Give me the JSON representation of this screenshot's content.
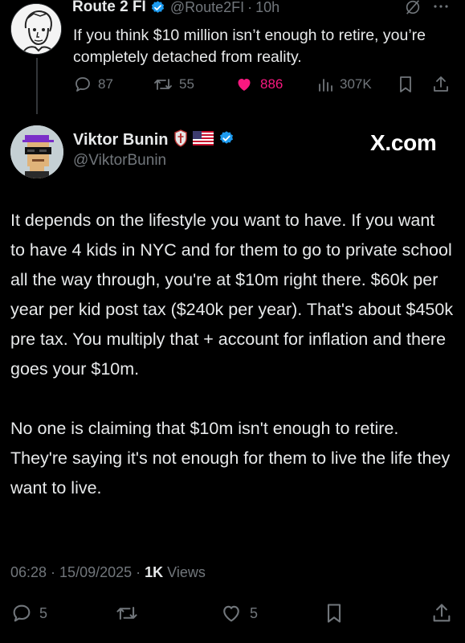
{
  "parent": {
    "name": "Route 2 FI",
    "handle": "@Route2FI",
    "separator": "·",
    "time": "10h",
    "text": "If you think $10 million isn’t enough to retire, you’re completely detached from reality.",
    "actions": {
      "replies": "87",
      "retweets": "55",
      "likes": "886",
      "views": "307K"
    },
    "liked": true
  },
  "tweet": {
    "name": "Viktor Bunin",
    "handle": "@ViktorBunin",
    "watermark": "X.com",
    "paragraphs": [
      "It depends on the lifestyle you want to have. If you want to have 4 kids in NYC and for them to go to private school all the way through, you're at $10m right there. $60k per year per kid post tax ($240k per year). That's about $450k pre tax. You multiply that + account for inflation and there goes your $10m.",
      "No one is claiming that $10m isn't enough to retire. They're saying it's not enough for them to live the life they want to live."
    ],
    "meta": {
      "time": "06:28",
      "dot1": " · ",
      "date": "15/09/2025",
      "dot2": " · ",
      "views_count": "1K",
      "views_label": " Views"
    },
    "actions": {
      "replies": "5",
      "likes": "5"
    }
  },
  "colors": {
    "background": "#000000",
    "text": "#e7e9ea",
    "muted": "#71767b",
    "verified": "#1d9bf0",
    "like": "#f91880"
  },
  "icons": {
    "verified": "verified-badge-icon",
    "reply": "reply-icon",
    "retweet": "retweet-icon",
    "like": "heart-icon",
    "views": "views-icon",
    "bookmark": "bookmark-icon",
    "share": "share-icon",
    "grok": "grok-icon",
    "more": "more-icon"
  }
}
